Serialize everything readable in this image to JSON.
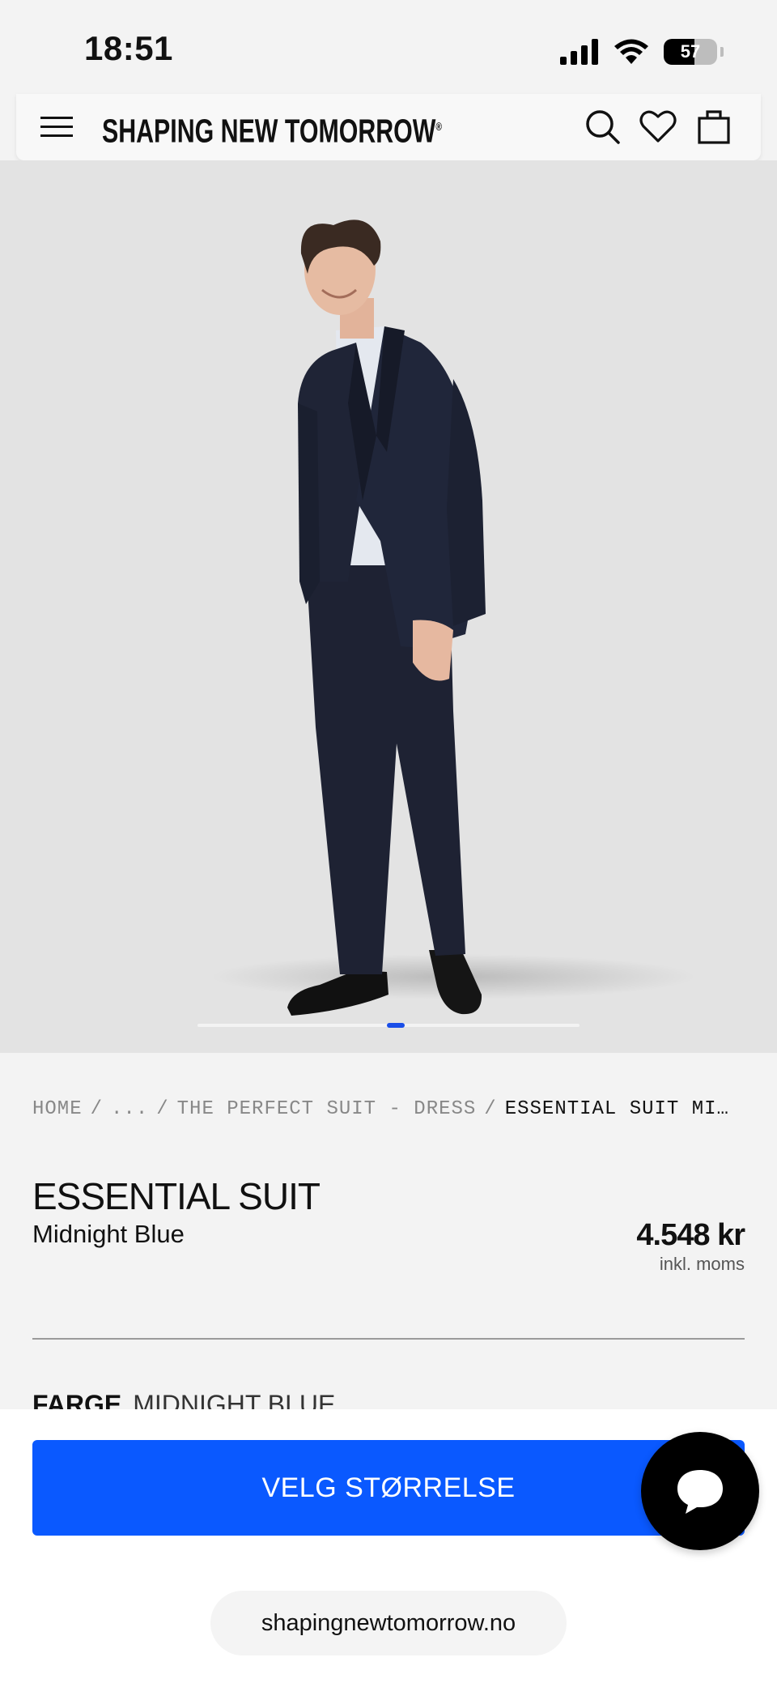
{
  "status_bar": {
    "time": "18:51",
    "battery": "57",
    "battery_level": 0.57,
    "icons": [
      "signal-icon",
      "wifi-icon",
      "battery-icon"
    ]
  },
  "header": {
    "brand": "SHAPING NEW TOMORROW",
    "brand_mark": "®",
    "icons": [
      "menu-icon",
      "search-icon",
      "heart-icon",
      "bag-icon"
    ]
  },
  "carousel": {
    "current_index": 1
  },
  "breadcrumb": {
    "items": [
      "HOME",
      "...",
      "THE PERFECT SUIT - DRESS"
    ],
    "separator": "/",
    "current": "ESSENTIAL SUIT MI…"
  },
  "product": {
    "title": "ESSENTIAL SUIT",
    "color": "Midnight Blue",
    "price": "4.548 kr",
    "price_note": "inkl. moms",
    "color_label": "FARGE",
    "color_value": "MIDNIGHT BLUE"
  },
  "actions": {
    "select_size": "VELG STØRRELSE"
  },
  "browser": {
    "url": "shapingnewtomorrow.no"
  },
  "colors": {
    "accent": "#0a59ff",
    "carousel_active": "#1a4ee8",
    "background": "#f3f3f3",
    "image_background": "#e3e3e3"
  }
}
